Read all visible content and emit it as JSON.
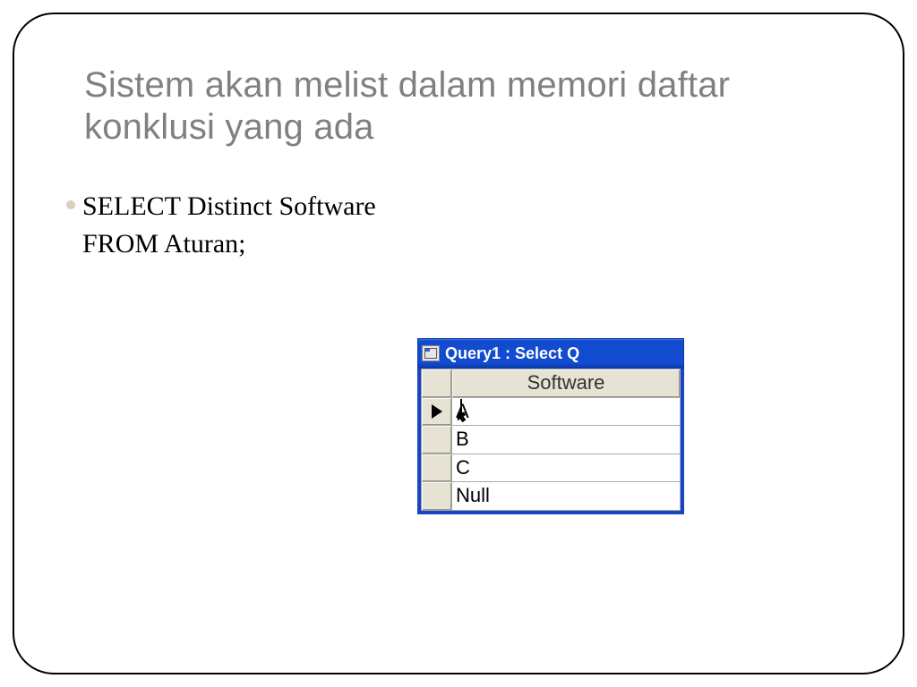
{
  "title": "Sistem akan melist dalam memori daftar konklusi yang ada",
  "sql": {
    "line1": "SELECT Distinct Software",
    "line2": "FROM Aturan;"
  },
  "query_window": {
    "title": "Query1 : Select Q",
    "column_header": "Software",
    "rows": [
      "A",
      "B",
      "C",
      "Null"
    ],
    "current_row_index": 0
  }
}
